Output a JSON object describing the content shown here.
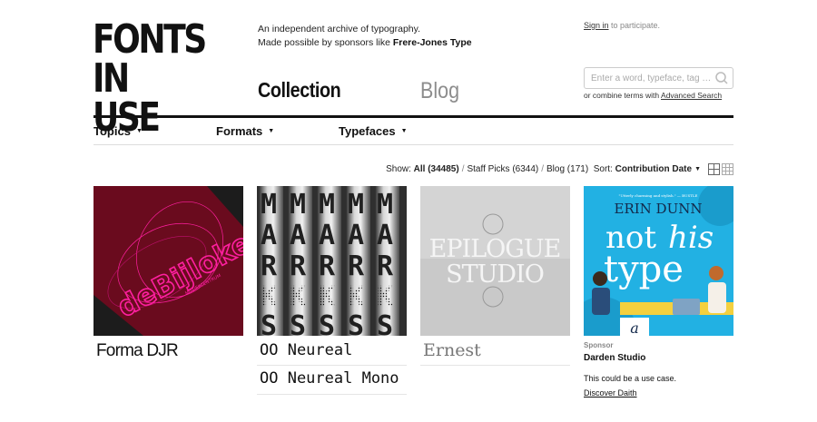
{
  "logo": {
    "line1": "FONTS",
    "line2": "IN USE"
  },
  "tagline": {
    "line1": "An independent archive of typography.",
    "line2_prefix": "Made possible by sponsors like ",
    "line2_sponsor": "Frere-Jones Type"
  },
  "account": {
    "signin_link": "Sign in",
    "signin_suffix": " to participate."
  },
  "main_nav": {
    "collection": "Collection",
    "blog": "Blog"
  },
  "search": {
    "placeholder": "Enter a word, typeface, tag …",
    "icon": "search-icon",
    "hint_prefix": "or combine terms with ",
    "hint_link": "Advanced Search"
  },
  "sub_nav": [
    {
      "label": "Topics",
      "icon": "caret-down-icon"
    },
    {
      "label": "Formats",
      "icon": "caret-down-icon"
    },
    {
      "label": "Typefaces",
      "icon": "caret-down-icon"
    }
  ],
  "filters": {
    "show_label": "Show:",
    "all": "All (34485)",
    "staff_picks": "Staff Picks (6344)",
    "blog": "Blog (171)",
    "sort_label": "Sort:",
    "sort_value": "Contribution Date"
  },
  "cards": [
    {
      "image_text": "deBijloke",
      "image_subtext": "MUZIEKCENTRUM",
      "fonts": [
        "Forma DJR"
      ]
    },
    {
      "image_letters": [
        "M",
        "A",
        "R",
        "K",
        "S"
      ],
      "fonts": [
        "OO Neureal",
        "OO Neureal Mono"
      ]
    },
    {
      "image_line1": "EPILOGUE",
      "image_line2": "STUDIO",
      "fonts": [
        "Ernest"
      ]
    },
    {
      "image_top": "\"Utterly charming and stylish.\" — BUSTLE",
      "image_author": "ERIN DUNN",
      "image_title_1": "not",
      "image_title_2": "his",
      "image_title_3": "type",
      "sponsor_label": "Sponsor",
      "sponsor_name": "Darden Studio",
      "sponsor_text": "This could be a use case.",
      "sponsor_link": "Discover Daith"
    }
  ],
  "colors": {
    "accent_pink": "#ff1fa0",
    "card1_bg": "#6a0b1e",
    "card4_bg": "#22b1e3"
  }
}
